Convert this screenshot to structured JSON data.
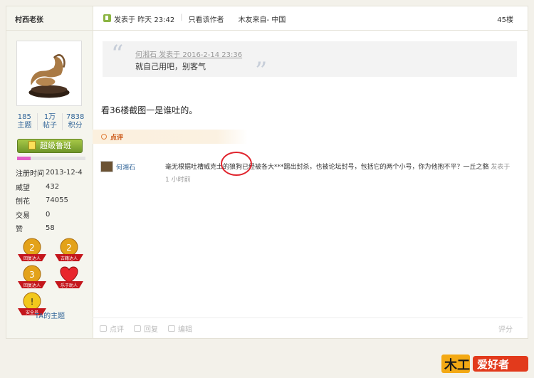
{
  "sidebar": {
    "username": "村西老张",
    "stats": [
      {
        "value": "185",
        "label": "主题"
      },
      {
        "value": "1万",
        "label": "帖子"
      },
      {
        "value": "7838",
        "label": "积分"
      }
    ],
    "rank_label": "超级鲁班",
    "rank_progress": 0.2,
    "info": [
      {
        "key": "注册时间",
        "value": "2013-12-4"
      },
      {
        "key": "威望",
        "value": "432"
      },
      {
        "key": "刨花",
        "value": "74055"
      },
      {
        "key": "交易",
        "value": "0"
      },
      {
        "key": "赞",
        "value": "58"
      }
    ],
    "medals": [
      {
        "label": "回复达人",
        "icon": "reply-medal-icon"
      },
      {
        "label": "古籍达人",
        "icon": "ancient-book-medal-icon"
      },
      {
        "label": "回复达人",
        "icon": "reply-medal-icon"
      },
      {
        "label": "乐于助人",
        "icon": "heart-medal-icon"
      },
      {
        "label": "安全员",
        "icon": "safety-medal-icon"
      }
    ],
    "ta_topics": "TA的主题"
  },
  "post": {
    "posted_label": "发表于 昨天 23:42",
    "only_author": "只看该作者",
    "from": "木友来自- 中国",
    "floor": "45楼",
    "quote_meta": "何湘石 发表于 2016-2-14 23:36",
    "quote_text": "就自己用吧，别客气",
    "body": "看36楼截图一是谁吐的。",
    "rate_label": "点评",
    "comment": {
      "user": "何湘石",
      "text": "毫无根据吐槽威克士的狼狗已经被各大***踢出封杀，也被论坛封号，包括它的两个小号，你为他抱不平？一丘之貉",
      "posted_suffix": "发表于",
      "time": "1 小时前"
    },
    "footer": {
      "rate": "点评",
      "reply": "回复",
      "edit": "编辑",
      "score": "评分"
    }
  },
  "watermark": {
    "text": "木工爱好者"
  },
  "colors": {
    "accent_green": "#8cb544",
    "link_blue": "#336699",
    "annotation_red": "#e0232c"
  }
}
